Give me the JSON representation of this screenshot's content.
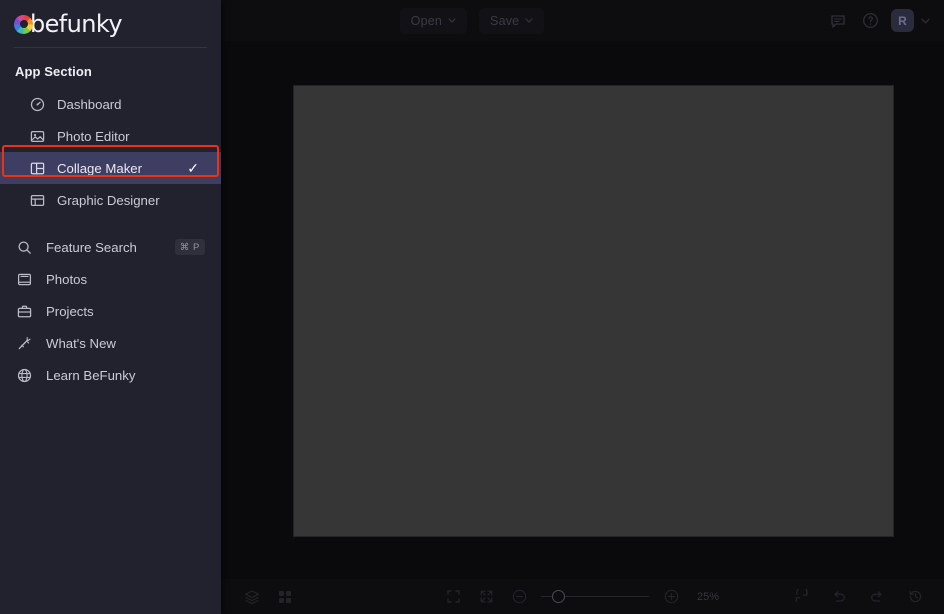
{
  "app": {
    "brand": "befunky",
    "brand_icon": "color-wheel-icon"
  },
  "topbar": {
    "open_label": "Open",
    "save_label": "Save",
    "chevron": "⌄",
    "icons": [
      {
        "name": "feedback-icon"
      },
      {
        "name": "help-circle-icon"
      }
    ],
    "avatar_initial": "R",
    "avatar_chevron": "⌄"
  },
  "sidebar": {
    "section_title": "App Section",
    "apps": [
      {
        "label": "Dashboard",
        "icon": "gauge-icon",
        "active": false
      },
      {
        "label": "Photo Editor",
        "icon": "image-icon",
        "active": false
      },
      {
        "label": "Collage Maker",
        "icon": "collage-grid-icon",
        "active": true,
        "check": "✓"
      },
      {
        "label": "Graphic Designer",
        "icon": "layout-icon",
        "active": false
      }
    ],
    "links": [
      {
        "label": "Feature Search",
        "icon": "search-icon",
        "shortcut": "⌘ P"
      },
      {
        "label": "Photos",
        "icon": "photos-icon",
        "shortcut": ""
      },
      {
        "label": "Projects",
        "icon": "briefcase-icon",
        "shortcut": ""
      },
      {
        "label": "What's New",
        "icon": "sparkle-icon",
        "shortcut": ""
      },
      {
        "label": "Learn BeFunky",
        "icon": "globe-icon",
        "shortcut": ""
      }
    ]
  },
  "bottombar": {
    "left_icons": [
      {
        "name": "layers-icon"
      },
      {
        "name": "grid-icon"
      }
    ],
    "fit_icon": "fit-to-screen-icon",
    "fullscreen_icon": "fullscreen-icon",
    "zoom_out_icon": "zoom-out-icon",
    "zoom_in_icon": "zoom-in-icon",
    "zoom_level": "25%",
    "right_icons": [
      {
        "name": "reset-icon"
      },
      {
        "name": "undo-icon"
      },
      {
        "name": "redo-icon"
      },
      {
        "name": "history-icon"
      }
    ]
  },
  "canvas": {
    "background_color": "#363636"
  },
  "colors": {
    "sidebar_bg": "#22222e",
    "active_item_bg": "#3e3e62",
    "highlight_border": "#f2300f",
    "canvas_fill": "#363636",
    "app_bg": "#0a0a0c"
  }
}
